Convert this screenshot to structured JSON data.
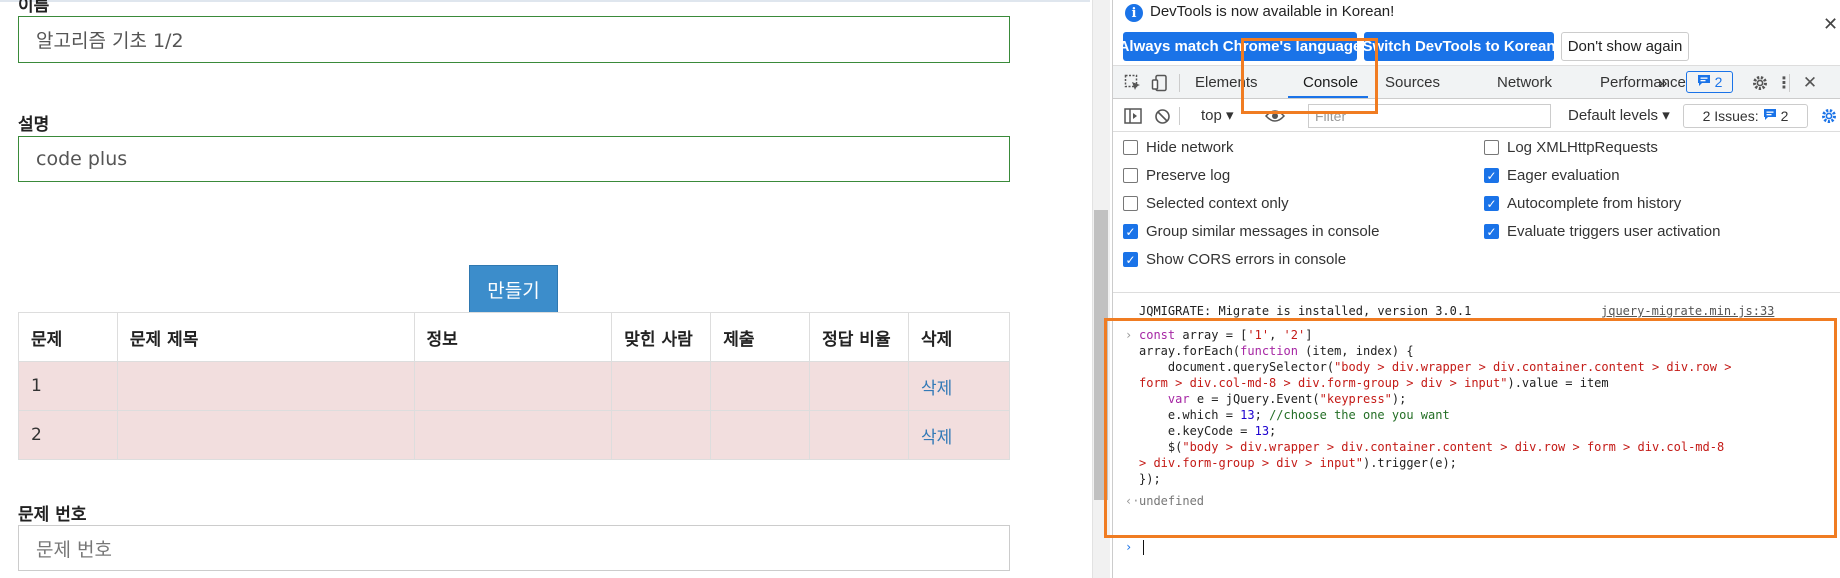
{
  "page": {
    "name_label": "이름",
    "name_value": "알고리즘 기초 1/2",
    "desc_label": "설명",
    "desc_value": "code plus",
    "create_button": "만들기",
    "table": {
      "headers": [
        "문제",
        "문제 제목",
        "정보",
        "맞힌 사람",
        "제출",
        "정답 비율",
        "삭제"
      ],
      "rows": [
        [
          "1",
          "",
          "",
          "",
          "",
          "",
          "삭제"
        ],
        [
          "2",
          "",
          "",
          "",
          "",
          "",
          "삭제"
        ]
      ]
    },
    "problem_no_label": "문제 번호",
    "problem_no_placeholder": "문제 번호"
  },
  "devtools": {
    "info": {
      "message": "DevTools is now available in Korean!",
      "btn_match": "Always match Chrome's language",
      "btn_switch": "Switch DevTools to Korean",
      "btn_dismiss": "Don't show again"
    },
    "tabs": [
      "Elements",
      "Console",
      "Sources",
      "Network",
      "Performance"
    ],
    "more_tabs": "»",
    "issue_count": "2",
    "context": "top ▾",
    "filter_placeholder": "Filter",
    "levels": "Default levels ▾",
    "issues_label": "2 Issues:",
    "issues_count": "2",
    "settings": {
      "hide_network": "Hide network",
      "preserve_log": "Preserve log",
      "selected_context": "Selected context only",
      "group_similar": "Group similar messages in console",
      "show_cors": "Show CORS errors in console",
      "log_xhr": "Log XMLHttpRequests",
      "eager_eval": "Eager evaluation",
      "autocomplete": "Autocomplete from history",
      "evaluate_triggers": "Evaluate triggers user activation"
    },
    "console": {
      "jqmigrate": "JQMIGRATE: Migrate is installed, version 3.0.1",
      "jqmigrate_src": "jquery-migrate.min.js:33",
      "code": {
        "l1a": "const",
        "l1b": " array = [",
        "l1c": "'1'",
        "l1d": ", ",
        "l1e": "'2'",
        "l1f": "]",
        "l2a": "array.forEach(",
        "l2b": "function",
        "l2c": " (item, index) {",
        "l3a": "    document.querySelector(",
        "l3b": "\"body > div.wrapper > div.container.content > div.row >",
        "l4a": "form > div.col-md-8 > div.form-group > div > input\"",
        "l4b": ").value = item",
        "l5a": "    ",
        "l5b": "var",
        "l5c": " e = jQuery.Event(",
        "l5d": "\"keypress\"",
        "l5e": ");",
        "l6a": "    e.which = ",
        "l6b": "13",
        "l6c": "; ",
        "l6d": "//choose the one you want",
        "l7a": "    e.keyCode = ",
        "l7b": "13",
        "l7c": ";",
        "l8a": "    $(",
        "l8b": "\"body > div.wrapper > div.container.content > div.row > form > div.col-md-8",
        "l9a": "> div.form-group > div > input\"",
        "l9b": ").trigger(e);",
        "l10": "});"
      },
      "result": "undefined"
    }
  },
  "colors": {
    "highlight": "#f07c22",
    "accent": "#1a73e8",
    "row_danger": "#f2dede",
    "primary_button": "#3c8dcb"
  }
}
